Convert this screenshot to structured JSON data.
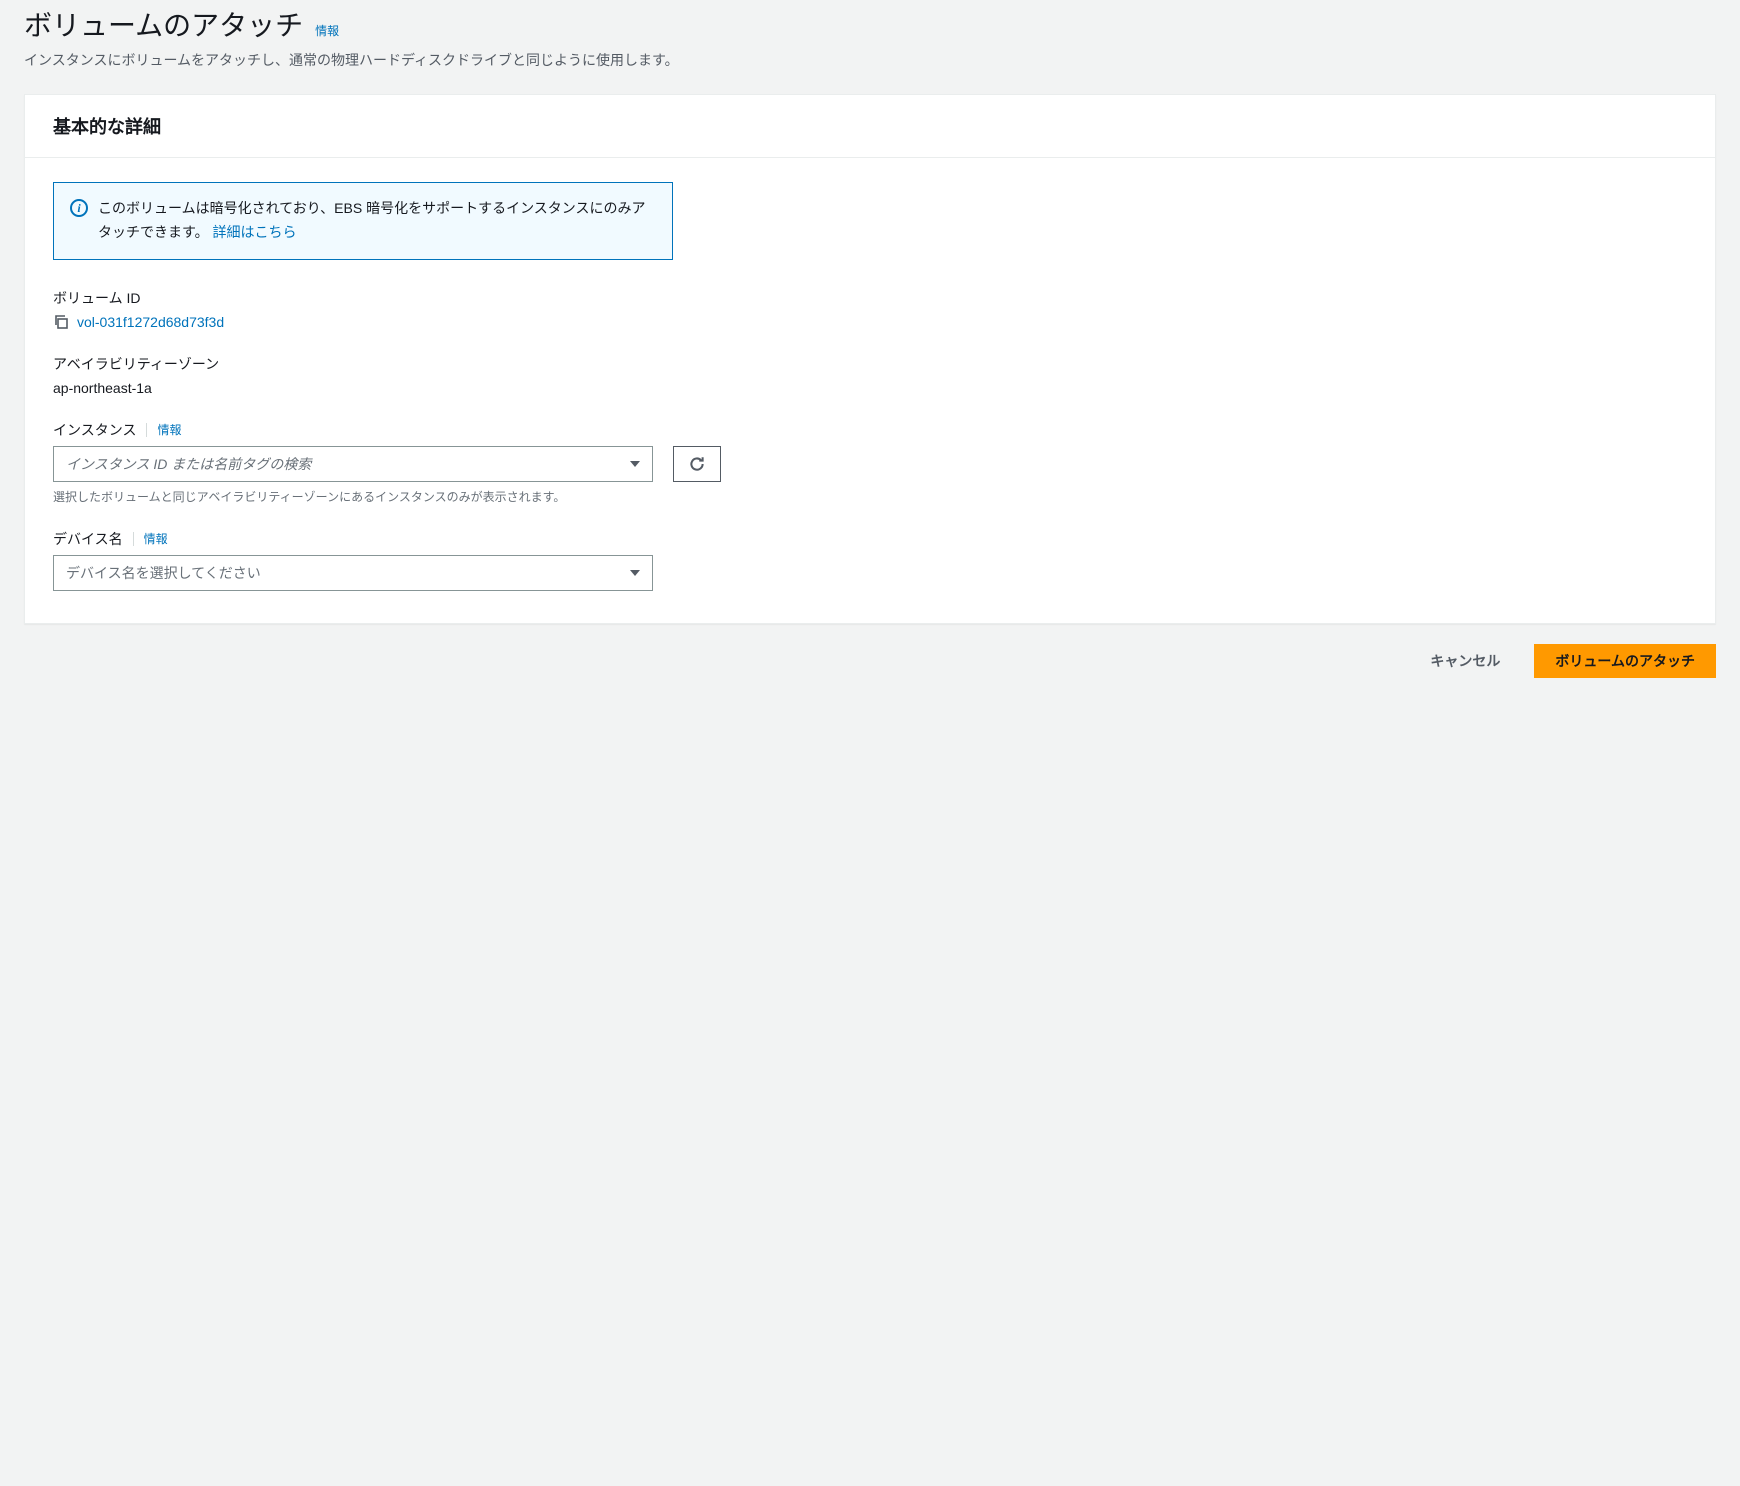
{
  "header": {
    "title": "ボリュームのアタッチ",
    "info_label": "情報",
    "description": "インスタンスにボリュームをアタッチし、通常の物理ハードディスクドライブと同じように使用します。"
  },
  "panel": {
    "title": "基本的な詳細",
    "alert": {
      "text_before_link": "このボリュームは暗号化されており、EBS 暗号化をサポートするインスタンスにのみアタッチできます。",
      "link_label": "詳細はこちら"
    },
    "volume_id": {
      "label": "ボリューム ID",
      "value": "vol-031f1272d68d73f3d"
    },
    "az": {
      "label": "アベイラビリティーゾーン",
      "value": "ap-northeast-1a"
    },
    "instance": {
      "label": "インスタンス",
      "info_label": "情報",
      "placeholder": "インスタンス ID または名前タグの検索",
      "help": "選択したボリュームと同じアベイラビリティーゾーンにあるインスタンスのみが表示されます。"
    },
    "device": {
      "label": "デバイス名",
      "info_label": "情報",
      "placeholder": "デバイス名を選択してください"
    }
  },
  "footer": {
    "cancel": "キャンセル",
    "submit": "ボリュームのアタッチ"
  }
}
